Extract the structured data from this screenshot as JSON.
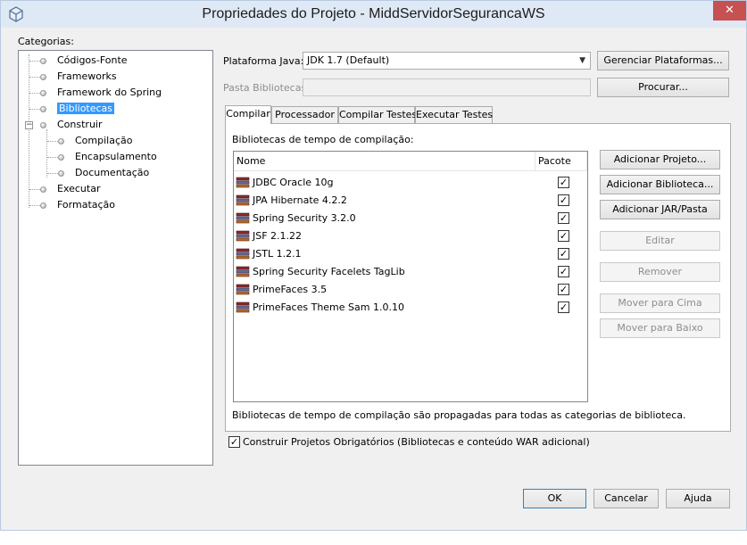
{
  "window": {
    "title": "Propriedades do Projeto - MiddServidorSegurancaWS",
    "close_glyph": "✕"
  },
  "categories": {
    "label": "Categorias:",
    "items": [
      {
        "label": "Códigos-Fonte"
      },
      {
        "label": "Frameworks"
      },
      {
        "label": "Framework do Spring"
      },
      {
        "label": "Bibliotecas",
        "selected": true
      },
      {
        "label": "Construir",
        "expanded": true
      },
      {
        "label": "Compilação"
      },
      {
        "label": "Encapsulamento"
      },
      {
        "label": "Documentação"
      },
      {
        "label": "Executar"
      },
      {
        "label": "Formatação"
      }
    ]
  },
  "platform": {
    "label": "Plataforma Java:",
    "value": "JDK 1.7 (Default)",
    "manage_button": "Gerenciar Plataformas..."
  },
  "libfolder": {
    "label": "Pasta Bibliotecas:",
    "value": "",
    "browse_button": "Procurar..."
  },
  "tabs": [
    {
      "label": "Compilar",
      "active": true
    },
    {
      "label": "Processador"
    },
    {
      "label": "Compilar Testes"
    },
    {
      "label": "Executar Testes"
    }
  ],
  "compile": {
    "section_label": "Bibliotecas de tempo de compilação:",
    "columns": [
      "Nome",
      "Pacote"
    ],
    "libraries": [
      {
        "name": "JDBC Oracle 10g",
        "package": true
      },
      {
        "name": "JPA Hibernate 4.2.2",
        "package": true
      },
      {
        "name": "Spring Security 3.2.0",
        "package": true
      },
      {
        "name": "JSF 2.1.22",
        "package": true
      },
      {
        "name": "JSTL 1.2.1",
        "package": true
      },
      {
        "name": "Spring Security Facelets TagLib",
        "package": true
      },
      {
        "name": "PrimeFaces 3.5",
        "package": true
      },
      {
        "name": "PrimeFaces Theme Sam 1.0.10",
        "package": true
      }
    ],
    "side_buttons": {
      "add_project": "Adicionar Projeto...",
      "add_library": "Adicionar Biblioteca...",
      "add_jar": "Adicionar JAR/Pasta",
      "edit": "Editar",
      "remove": "Remover",
      "move_up": "Mover para Cima",
      "move_down": "Mover para Baixo"
    },
    "note": "Bibliotecas de tempo de compilação são propagadas para todas as categorias de biblioteca."
  },
  "build_required": {
    "checked": true,
    "label": "Construir Projetos Obrigatórios (Bibliotecas e conteúdo WAR adicional)"
  },
  "footer": {
    "ok": "OK",
    "cancel": "Cancelar",
    "help": "Ajuda"
  },
  "colors": {
    "selection": "#3399ff",
    "titlebar": "#dfe9f5",
    "close": "#c75050",
    "dialog_bg": "#f0f0f0"
  }
}
